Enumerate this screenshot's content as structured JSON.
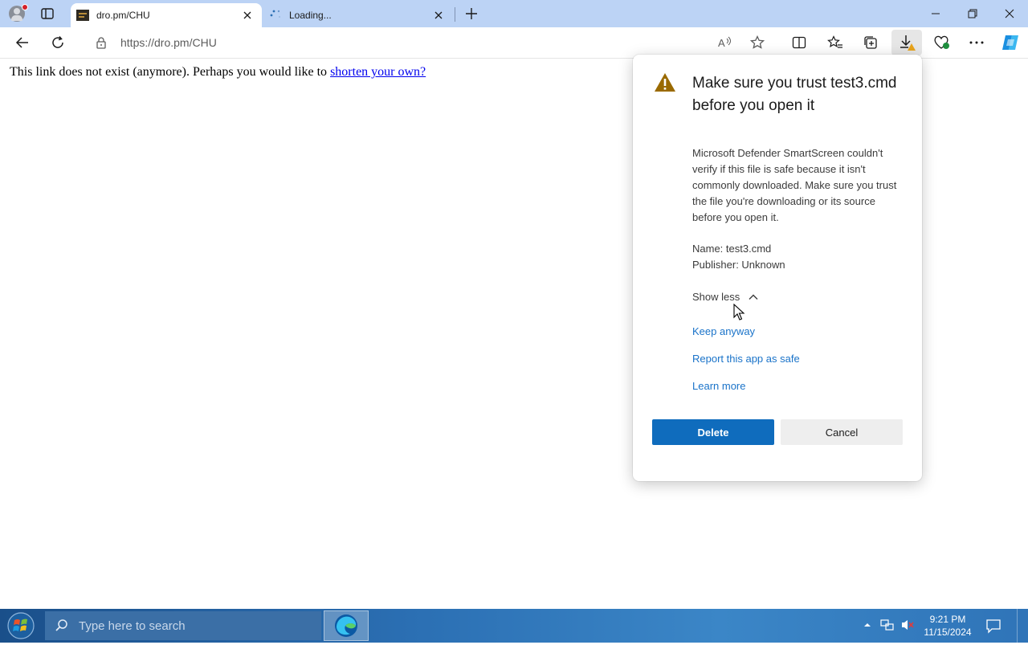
{
  "browser": {
    "tabs": [
      {
        "label": "dro.pm/CHU",
        "active": true
      },
      {
        "label": "Loading...",
        "active": false
      }
    ],
    "address": {
      "url": "https://dro.pm/CHU"
    }
  },
  "page": {
    "message_text": "This link does not exist (anymore). Perhaps you would like to ",
    "message_link": "shorten your own?"
  },
  "download_flyout": {
    "title": "Make sure you trust test3.cmd before you open it",
    "description": "Microsoft Defender SmartScreen couldn't verify if this file is safe because it isn't commonly downloaded. Make sure you trust the file you're downloading or its source before you open it.",
    "name_line": "Name: test3.cmd",
    "publisher_line": "Publisher: Unknown",
    "show_less": "Show less",
    "keep_anyway": "Keep anyway",
    "report_safe": "Report this app as safe",
    "learn_more": "Learn more",
    "delete_label": "Delete",
    "cancel_label": "Cancel"
  },
  "taskbar": {
    "search_placeholder": "Type here to search",
    "time": "9:21 PM",
    "date": "11/15/2024"
  },
  "colors": {
    "tabstrip": "#bcd3f5",
    "primary_button": "#0f6cbd",
    "link": "#1a73c9",
    "warning": "#9a6a00"
  }
}
